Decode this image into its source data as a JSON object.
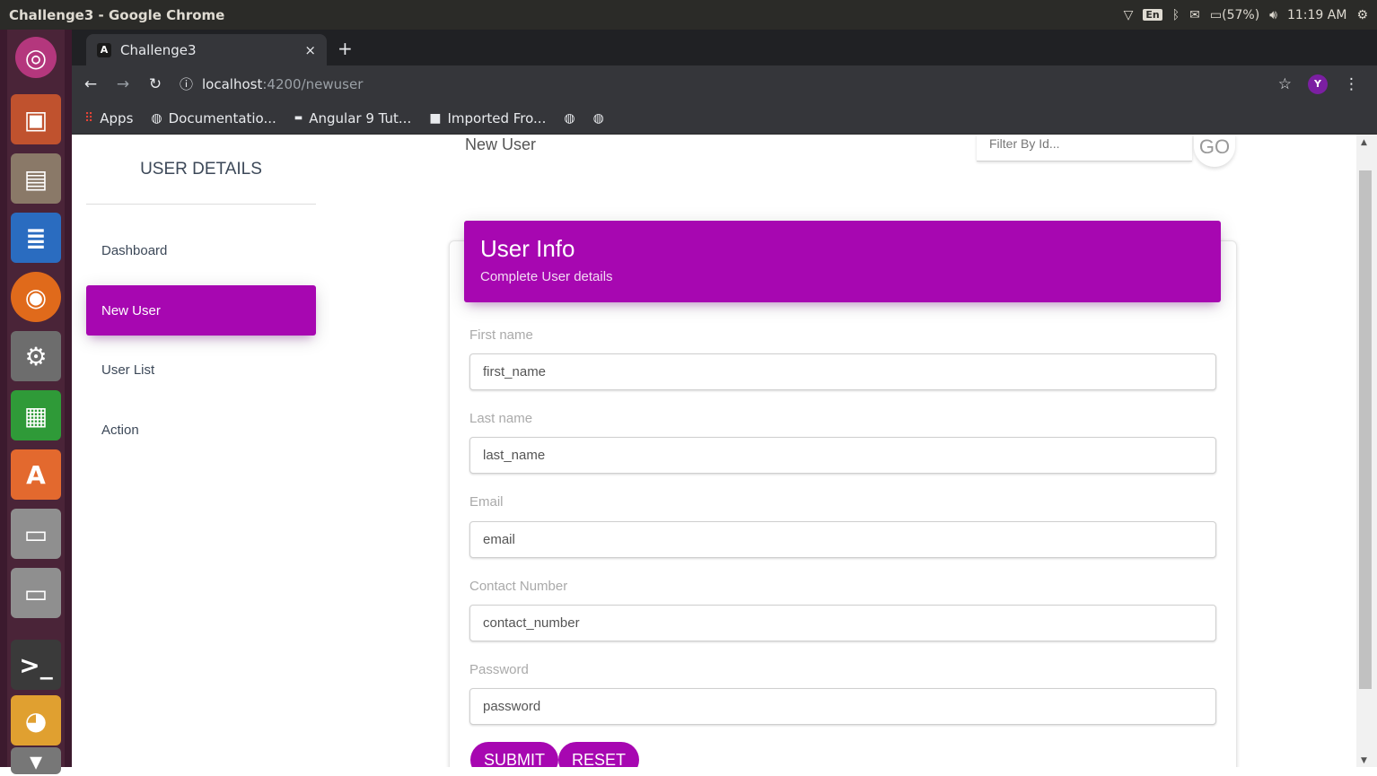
{
  "os": {
    "window_title": "Challenge3 - Google Chrome",
    "tray": {
      "lang": "En",
      "battery": "(57%)",
      "time": "11:19 AM"
    }
  },
  "launcher": {
    "items": [
      "ubuntu-dash-icon",
      "impress-icon",
      "files-icon",
      "writer-icon",
      "firefox-icon",
      "settings-icon",
      "calc-icon",
      "software-center-icon",
      "drive-icon",
      "drive-icon",
      "terminal-icon",
      "chrome-icon",
      "trash-icon"
    ]
  },
  "browser": {
    "tab_title": "Challenge3",
    "tab_close": "×",
    "new_tab": "+",
    "url_host": "localhost",
    "url_path": ":4200/newuser",
    "profile_initial": "Y",
    "bookmarks": [
      {
        "label": "Apps",
        "icon": "apps-grid-icon"
      },
      {
        "label": "Documentatio...",
        "icon": "globe-icon"
      },
      {
        "label": "Angular 9 Tut...",
        "icon": "site-favicon-icon"
      },
      {
        "label": "Imported Fro...",
        "icon": "folder-icon"
      }
    ]
  },
  "sidebar": {
    "title": "USER DETAILS",
    "items": [
      {
        "label": "Dashboard",
        "active": false
      },
      {
        "label": "New User",
        "active": true
      },
      {
        "label": "User List",
        "active": false
      },
      {
        "label": "Action",
        "active": false
      }
    ]
  },
  "navbar": {
    "brand": "New User",
    "filter_placeholder": "Filter By Id...",
    "go_label": "GO"
  },
  "card": {
    "title": "User Info",
    "subtitle": "Complete User details",
    "fields": [
      {
        "label": "First name",
        "value": "first_name"
      },
      {
        "label": "Last name",
        "value": "last_name"
      },
      {
        "label": "Email",
        "value": "email"
      },
      {
        "label": "Contact Number",
        "value": "contact_number"
      },
      {
        "label": "Password",
        "value": "password"
      }
    ],
    "submit_label": "SUBMIT",
    "reset_label": "RESET"
  },
  "colors": {
    "accent": "#a707b1",
    "chrome_dark": "#35363a"
  }
}
